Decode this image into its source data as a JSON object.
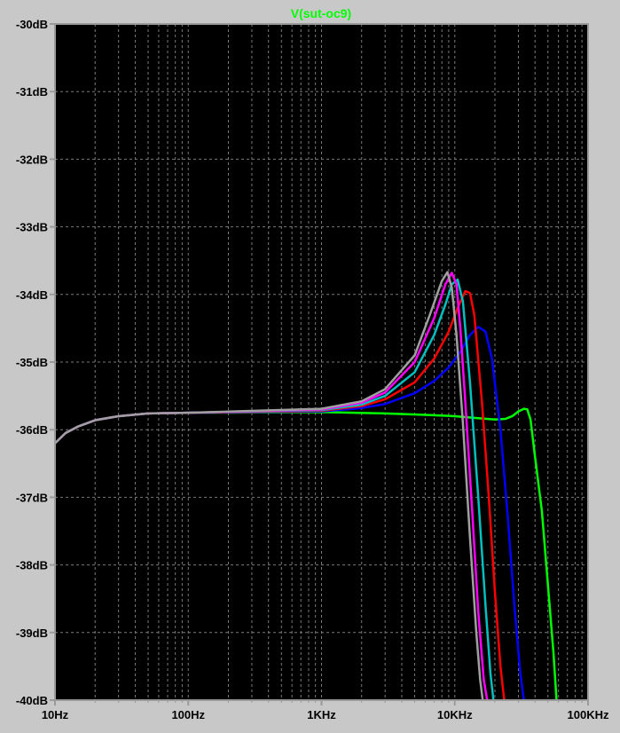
{
  "window": {
    "frame_color": "#c8c8c8",
    "plot_background": "#000000",
    "grid_color": "#7a7a7a",
    "axis_color": "#9a9a9a",
    "tick_label_color": "#000000"
  },
  "chart_data": {
    "type": "line",
    "title": "V(sut-oc9)",
    "title_color": "#00ff00",
    "x_scale": "log",
    "x_unit": "Hz",
    "xlim": [
      10,
      100000
    ],
    "x_ticks": [
      10,
      100,
      1000,
      10000,
      100000
    ],
    "x_tick_labels": [
      "10Hz",
      "100Hz",
      "1KHz",
      "10KHz",
      "100KHz"
    ],
    "ylim": [
      -40,
      -30
    ],
    "y_unit": "dB",
    "y_ticks": [
      -30,
      -31,
      -32,
      -33,
      -34,
      -35,
      -36,
      -37,
      -38,
      -39,
      -40
    ],
    "y_tick_labels": [
      "-30dB",
      "-31dB",
      "-32dB",
      "-33dB",
      "-34dB",
      "-35dB",
      "-36dB",
      "-37dB",
      "-38dB",
      "-39dB",
      "-40dB"
    ],
    "grid": true,
    "series": [
      {
        "color": "#00ff00",
        "points": [
          [
            10,
            -36.2
          ],
          [
            12,
            -36.05
          ],
          [
            15,
            -35.95
          ],
          [
            20,
            -35.86
          ],
          [
            30,
            -35.8
          ],
          [
            50,
            -35.76
          ],
          [
            100,
            -35.75
          ],
          [
            1000,
            -35.74
          ],
          [
            3000,
            -35.76
          ],
          [
            6000,
            -35.78
          ],
          [
            10000,
            -35.8
          ],
          [
            15000,
            -35.83
          ],
          [
            20000,
            -35.85
          ],
          [
            24000,
            -35.84
          ],
          [
            27000,
            -35.8
          ],
          [
            30000,
            -35.73
          ],
          [
            33000,
            -35.69
          ],
          [
            35000,
            -35.7
          ],
          [
            37000,
            -35.85
          ],
          [
            40000,
            -36.4
          ],
          [
            45000,
            -37.2
          ],
          [
            50000,
            -38.3
          ],
          [
            55000,
            -39.3
          ],
          [
            58000,
            -40
          ]
        ]
      },
      {
        "color": "#0000ff",
        "points": [
          [
            10,
            -36.2
          ],
          [
            12,
            -36.05
          ],
          [
            15,
            -35.95
          ],
          [
            20,
            -35.86
          ],
          [
            30,
            -35.8
          ],
          [
            50,
            -35.76
          ],
          [
            100,
            -35.75
          ],
          [
            1000,
            -35.73
          ],
          [
            2000,
            -35.68
          ],
          [
            3000,
            -35.62
          ],
          [
            5000,
            -35.46
          ],
          [
            7000,
            -35.28
          ],
          [
            9000,
            -35.08
          ],
          [
            11000,
            -34.85
          ],
          [
            13000,
            -34.6
          ],
          [
            15000,
            -34.48
          ],
          [
            17000,
            -34.55
          ],
          [
            19000,
            -34.95
          ],
          [
            22000,
            -36.0
          ],
          [
            25000,
            -37.3
          ],
          [
            28000,
            -38.6
          ],
          [
            31000,
            -39.6
          ],
          [
            33000,
            -40
          ]
        ]
      },
      {
        "color": "#ff0000",
        "points": [
          [
            10,
            -36.2
          ],
          [
            12,
            -36.05
          ],
          [
            15,
            -35.95
          ],
          [
            20,
            -35.86
          ],
          [
            30,
            -35.8
          ],
          [
            50,
            -35.76
          ],
          [
            100,
            -35.75
          ],
          [
            1000,
            -35.72
          ],
          [
            2000,
            -35.65
          ],
          [
            3000,
            -35.55
          ],
          [
            5000,
            -35.3
          ],
          [
            7000,
            -34.95
          ],
          [
            9000,
            -34.55
          ],
          [
            10500,
            -34.2
          ],
          [
            12000,
            -33.95
          ],
          [
            13000,
            -33.98
          ],
          [
            14000,
            -34.3
          ],
          [
            16000,
            -35.6
          ],
          [
            18000,
            -37.0
          ],
          [
            20000,
            -38.4
          ],
          [
            22000,
            -39.5
          ],
          [
            23500,
            -40
          ]
        ]
      },
      {
        "color": "#00c0c0",
        "points": [
          [
            10,
            -36.2
          ],
          [
            12,
            -36.05
          ],
          [
            15,
            -35.95
          ],
          [
            20,
            -35.86
          ],
          [
            30,
            -35.8
          ],
          [
            50,
            -35.76
          ],
          [
            100,
            -35.75
          ],
          [
            1000,
            -35.71
          ],
          [
            2000,
            -35.63
          ],
          [
            3000,
            -35.5
          ],
          [
            5000,
            -35.15
          ],
          [
            7000,
            -34.6
          ],
          [
            8500,
            -34.15
          ],
          [
            9500,
            -33.85
          ],
          [
            10500,
            -33.78
          ],
          [
            11500,
            -34.1
          ],
          [
            13000,
            -35.3
          ],
          [
            15000,
            -37.0
          ],
          [
            17000,
            -38.6
          ],
          [
            18500,
            -39.6
          ],
          [
            19500,
            -40
          ]
        ]
      },
      {
        "color": "#ff00ff",
        "points": [
          [
            10,
            -36.2
          ],
          [
            12,
            -36.05
          ],
          [
            15,
            -35.95
          ],
          [
            20,
            -35.86
          ],
          [
            30,
            -35.8
          ],
          [
            50,
            -35.76
          ],
          [
            100,
            -35.75
          ],
          [
            1000,
            -35.7
          ],
          [
            2000,
            -35.6
          ],
          [
            3000,
            -35.45
          ],
          [
            5000,
            -35.0
          ],
          [
            7000,
            -34.35
          ],
          [
            8500,
            -33.85
          ],
          [
            9500,
            -33.68
          ],
          [
            10300,
            -33.85
          ],
          [
            11000,
            -34.5
          ],
          [
            12000,
            -35.6
          ],
          [
            13500,
            -37.2
          ],
          [
            15000,
            -38.7
          ],
          [
            16500,
            -39.7
          ],
          [
            17500,
            -40
          ]
        ]
      },
      {
        "color": "#a0a0a0",
        "points": [
          [
            10,
            -36.2
          ],
          [
            12,
            -36.05
          ],
          [
            15,
            -35.95
          ],
          [
            20,
            -35.86
          ],
          [
            30,
            -35.8
          ],
          [
            50,
            -35.76
          ],
          [
            100,
            -35.75
          ],
          [
            1000,
            -35.69
          ],
          [
            2000,
            -35.58
          ],
          [
            3000,
            -35.4
          ],
          [
            5000,
            -34.9
          ],
          [
            6500,
            -34.3
          ],
          [
            8000,
            -33.8
          ],
          [
            8800,
            -33.67
          ],
          [
            9500,
            -33.9
          ],
          [
            10300,
            -34.6
          ],
          [
            11500,
            -35.9
          ],
          [
            13000,
            -37.6
          ],
          [
            14500,
            -39.0
          ],
          [
            15500,
            -39.7
          ],
          [
            16200,
            -40
          ]
        ]
      }
    ]
  }
}
